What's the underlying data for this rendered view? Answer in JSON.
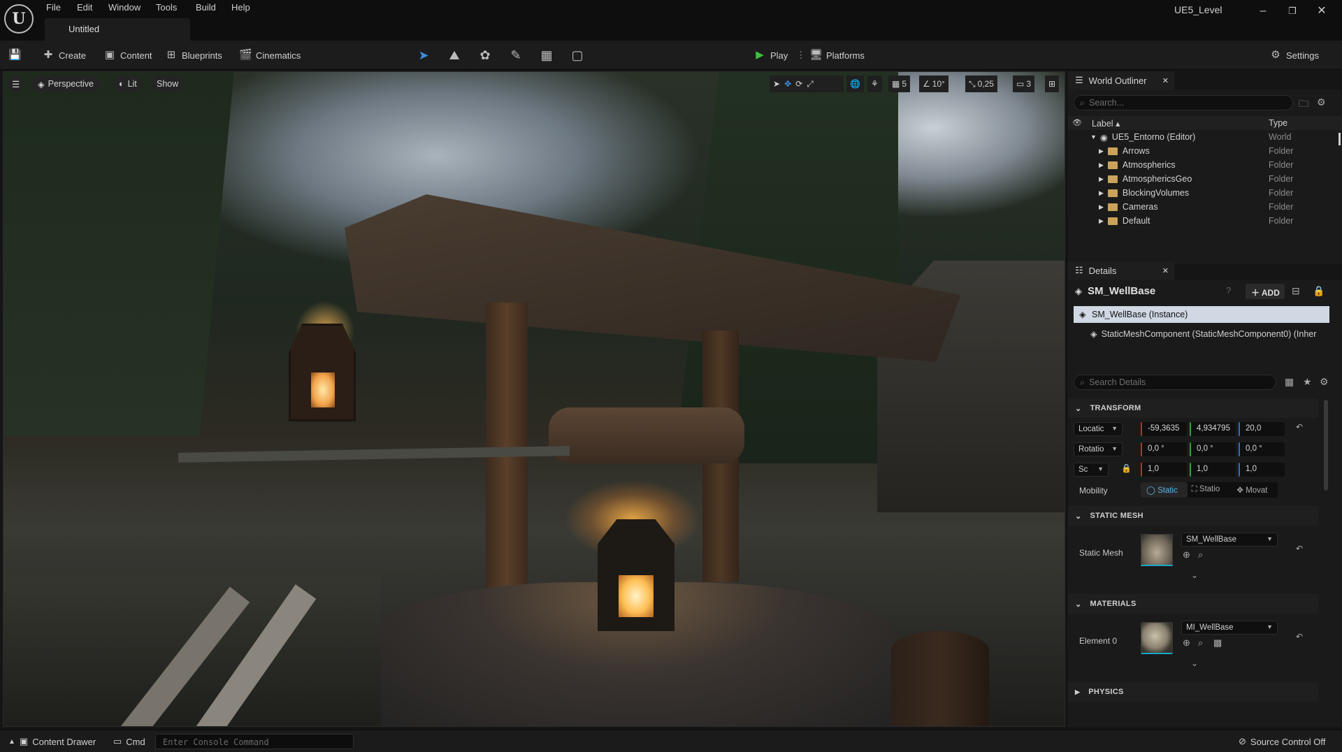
{
  "menu": [
    "File",
    "Edit",
    "Window",
    "Tools",
    "Build",
    "Help"
  ],
  "document_tab": "Untitled",
  "level_name": "UE5_Level",
  "window_controls": {
    "minimize": "–",
    "maximize": "❐",
    "close": "✕"
  },
  "toolbar": {
    "create": "Create",
    "content": "Content",
    "blueprints": "Blueprints",
    "cinematics": "Cinematics",
    "play": "Play",
    "platforms": "Platforms",
    "settings": "Settings"
  },
  "viewport": {
    "perspective": "Perspective",
    "lit": "Lit",
    "show": "Show",
    "grid_snap": "5",
    "rotation_snap": "10°",
    "scale_snap": "0,25",
    "camera_speed": "3"
  },
  "world_outliner": {
    "tab": "World Outliner",
    "search_placeholder": "Search...",
    "col_label": "Label",
    "col_type": "Type",
    "root": {
      "label": "UE5_Entorno (Editor)",
      "type": "World"
    },
    "items": [
      {
        "label": "Arrows",
        "type": "Folder"
      },
      {
        "label": "Atmospherics",
        "type": "Folder"
      },
      {
        "label": "AtmosphericsGeo",
        "type": "Folder"
      },
      {
        "label": "BlockingVolumes",
        "type": "Folder"
      },
      {
        "label": "Cameras",
        "type": "Folder"
      },
      {
        "label": "Default",
        "type": "Folder"
      }
    ]
  },
  "details": {
    "tab": "Details",
    "actor_name": "SM_WellBase",
    "add_label": "ADD",
    "instance_row": "SM_WellBase  (Instance)",
    "component_row": "StaticMeshComponent (StaticMeshComponent0) (Inher",
    "search_placeholder": "Search Details",
    "transform": {
      "section": "TRANSFORM",
      "location_label": "Locatic",
      "rotation_label": "Rotatio",
      "scale_label": "Sc",
      "location": [
        "-59,3635",
        "4,934795",
        "20,0"
      ],
      "rotation": [
        "0,0 °",
        "0,0 °",
        "0,0 °"
      ],
      "scale": [
        "1,0",
        "1,0",
        "1,0"
      ],
      "mobility_label": "Mobility",
      "mobility_options": [
        "Static",
        "Statio",
        "Movat"
      ]
    },
    "static_mesh": {
      "section": "STATIC MESH",
      "label": "Static Mesh",
      "value": "SM_WellBase"
    },
    "materials": {
      "section": "MATERIALS",
      "label": "Element 0",
      "value": "MI_WellBase"
    },
    "physics": {
      "section": "PHYSICS"
    }
  },
  "bottom": {
    "content_drawer": "Content Drawer",
    "cmd": "Cmd",
    "console_placeholder": "Enter Console Command",
    "source_control": "Source Control Off"
  },
  "colors": {
    "x_axis": "#c42b2b",
    "y_axis": "#3f9a3f",
    "z_axis": "#2f6bd1",
    "accent": "#1ba7c7",
    "play_green": "#3fbf3f",
    "selection": "#cfd8e3"
  }
}
